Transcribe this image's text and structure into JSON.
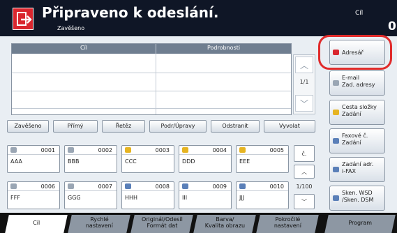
{
  "header": {
    "title": "Připraveno k odeslání.",
    "subtitle": "Zavěšeno",
    "dest_label": "Cíl",
    "dest_count": "0"
  },
  "dest_table": {
    "col_dest": "Cíl",
    "col_details": "Podrobnosti",
    "page": "1/1"
  },
  "actions": [
    "Zavěšeno",
    "Přímý",
    "Řetěz",
    "Podr/Úpravy",
    "Odstranit",
    "Vyvolat"
  ],
  "right_buttons": [
    {
      "label": "Adresář",
      "icon": "address-book-icon",
      "color": "#d9262e"
    },
    {
      "label": "E-mail\nZad. adresy",
      "icon": "email-icon",
      "color": "#9aa6b4"
    },
    {
      "label": "Cesta složky\nZadání",
      "icon": "folder-icon",
      "color": "#e6b422"
    },
    {
      "label": "Faxové č.\nZadání",
      "icon": "fax-icon",
      "color": "#5a7fb8"
    },
    {
      "label": "Zadání adr.\ni-FAX",
      "icon": "ifax-icon",
      "color": "#5a7fb8"
    },
    {
      "label": "Sken. WSD\n/Sken. DSM",
      "icon": "scan-icon",
      "color": "#5a7fb8"
    }
  ],
  "address_book": [
    {
      "num": "0001",
      "name": "AAA",
      "icon": "email-icon",
      "color": "#9aa6b4"
    },
    {
      "num": "0002",
      "name": "BBB",
      "icon": "email-icon",
      "color": "#9aa6b4"
    },
    {
      "num": "0003",
      "name": "CCC",
      "icon": "folder-icon",
      "color": "#e6b422"
    },
    {
      "num": "0004",
      "name": "DDD",
      "icon": "folder-icon",
      "color": "#e6b422"
    },
    {
      "num": "0005",
      "name": "EEE",
      "icon": "folder-icon",
      "color": "#e6b422"
    },
    {
      "num": "0006",
      "name": "FFF",
      "icon": "email-icon",
      "color": "#9aa6b4"
    },
    {
      "num": "0007",
      "name": "GGG",
      "icon": "email-icon",
      "color": "#9aa6b4"
    },
    {
      "num": "0008",
      "name": "HHH",
      "icon": "fax-icon",
      "color": "#5a7fb8"
    },
    {
      "num": "0009",
      "name": "III",
      "icon": "fax-icon",
      "color": "#5a7fb8"
    },
    {
      "num": "0010",
      "name": "JJJ",
      "icon": "fax-icon",
      "color": "#5a7fb8"
    }
  ],
  "ab_side": {
    "letter": "č.",
    "page": "1/100"
  },
  "tabs": [
    {
      "label": "Cíl",
      "active": true
    },
    {
      "label": "Rychlé\nnastavení",
      "active": false
    },
    {
      "label": "Originál/Odesíl\nFormát dat",
      "active": false
    },
    {
      "label": "Barva/\nKvalita obrazu",
      "active": false
    },
    {
      "label": "Pokročilé\nnastavení",
      "active": false
    },
    {
      "label": "Program",
      "active": false
    }
  ]
}
